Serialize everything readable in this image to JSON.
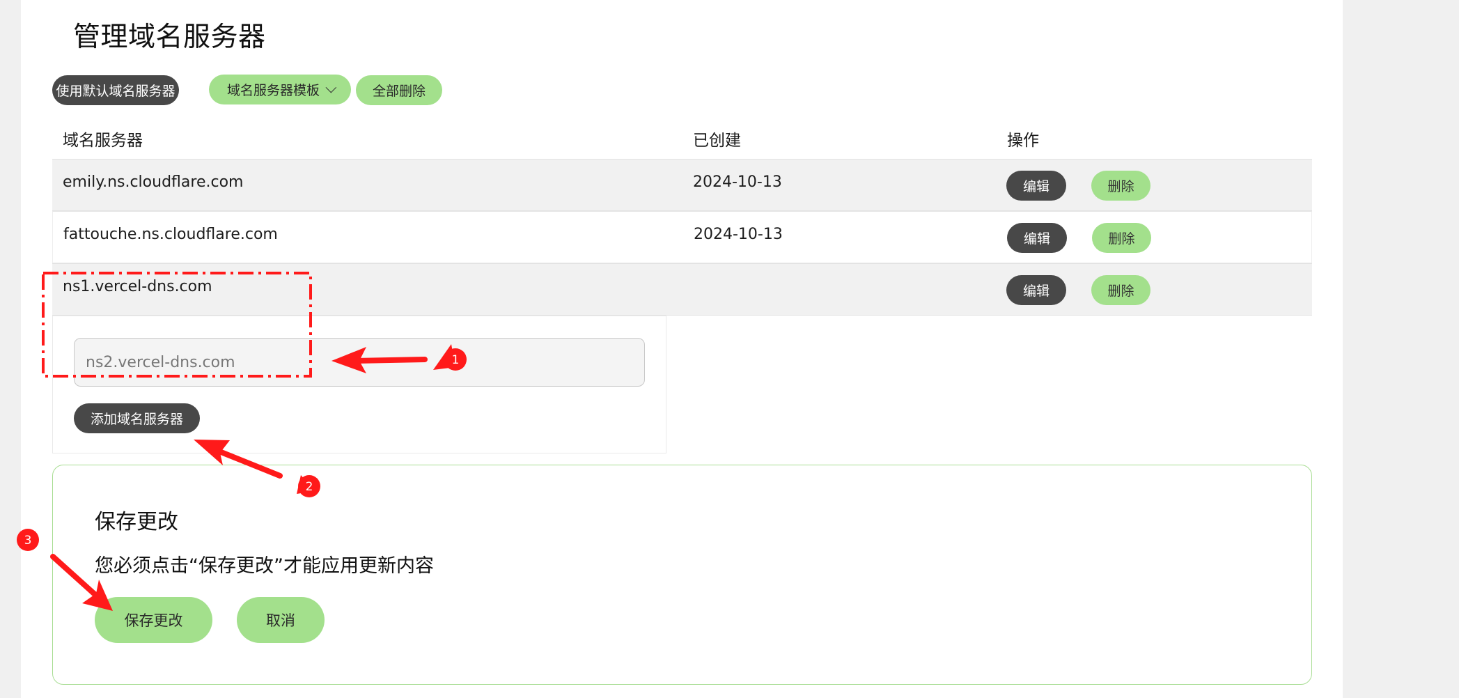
{
  "page_title": "管理域名服务器",
  "toolbar": {
    "default_ns_label": "使用默认域名服务器",
    "template_label": "域名服务器模板",
    "delete_all_label": "全部删除"
  },
  "table": {
    "headers": [
      "域名服务器",
      "已创建",
      "操作"
    ],
    "rows": [
      {
        "name": "emily.ns.cloudflare.com",
        "created": "2024-10-13",
        "edit": "编辑",
        "delete": "删除"
      },
      {
        "name": "fattouche.ns.cloudflare.com",
        "created": "2024-10-13",
        "edit": "编辑",
        "delete": "删除"
      },
      {
        "name": "ns1.vercel-dns.com",
        "created": "",
        "edit": "编辑",
        "delete": "删除"
      }
    ]
  },
  "add_nameserver": {
    "input_value": "ns2.vercel-dns.com",
    "button_label": "添加域名服务器"
  },
  "save_panel": {
    "title": "保存更改",
    "description": "您必须点击“保存更改”才能应用更新内容",
    "save_label": "保存更改",
    "cancel_label": "取消"
  },
  "annotations": {
    "step1": "1",
    "step2": "2",
    "step3": "3",
    "color": "#ff1a1a"
  }
}
